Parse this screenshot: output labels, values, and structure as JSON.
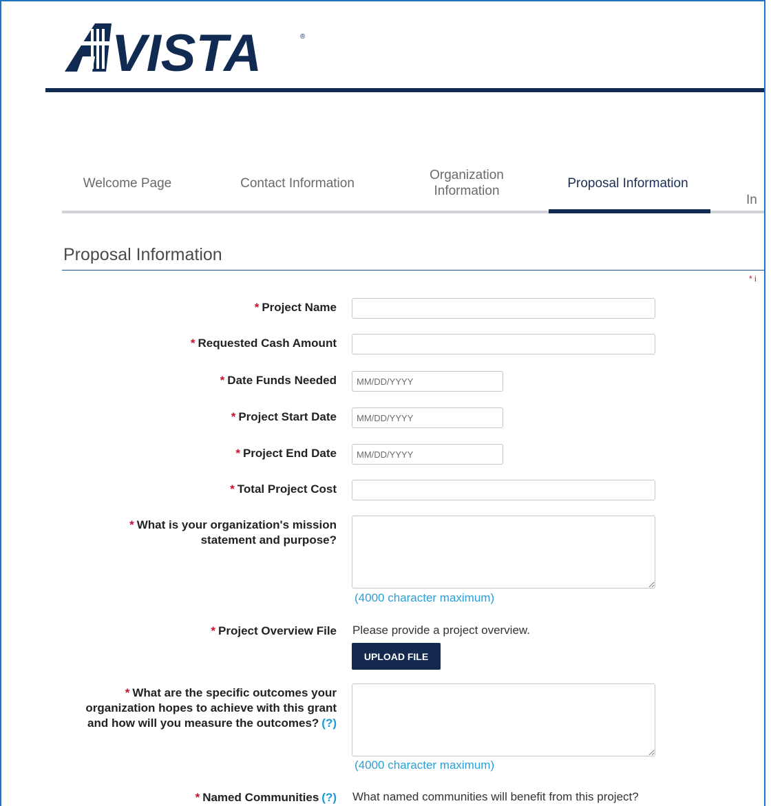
{
  "brand": {
    "logo_text": "AVISTA",
    "primary_color": "#112a52",
    "accent_red": "#c8102e",
    "link_color": "#2a9fd6"
  },
  "tabs": [
    {
      "label": "Welcome Page",
      "active": false
    },
    {
      "label": "Contact Information",
      "active": false
    },
    {
      "label": "Organization Information",
      "active": false
    },
    {
      "label": "Proposal Information",
      "active": true
    },
    {
      "label": "In",
      "active": false
    }
  ],
  "section": {
    "title": "Proposal Information",
    "required_note": "* i"
  },
  "fields": {
    "project_name": {
      "label": "Project Name",
      "value": ""
    },
    "requested_cash_amount": {
      "label": "Requested Cash Amount",
      "value": ""
    },
    "date_funds_needed": {
      "label": "Date Funds Needed",
      "placeholder": "MM/DD/YYYY"
    },
    "project_start_date": {
      "label": "Project Start Date",
      "placeholder": "MM/DD/YYYY"
    },
    "project_end_date": {
      "label": "Project End Date",
      "placeholder": "MM/DD/YYYY"
    },
    "total_project_cost": {
      "label": "Total Project Cost",
      "value": ""
    },
    "mission_statement": {
      "label": "What is your organization's mission statement and purpose?",
      "hint": "(4000 character maximum)"
    },
    "project_overview_file": {
      "label": "Project Overview File",
      "description": "Please provide a project overview.",
      "button": "UPLOAD FILE"
    },
    "specific_outcomes": {
      "label": "What are the specific outcomes your organization hopes to achieve with this grant and how will you measure the outcomes?",
      "help": "(?)",
      "hint": "(4000 character maximum)"
    },
    "named_communities": {
      "label": "Named Communities",
      "help": "(?)",
      "description": "What named communities will benefit from this project?"
    }
  },
  "required_marker": "*"
}
